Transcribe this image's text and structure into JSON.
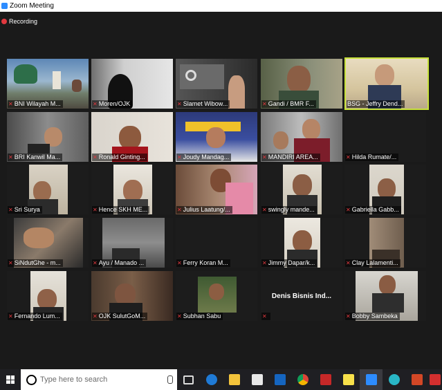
{
  "window": {
    "title": "Zoom Meeting"
  },
  "status": {
    "recording_label": "Recording"
  },
  "participants": [
    "BNI Wilayah M...",
    "Moren/OJK",
    "Slamet Wibow...",
    "Gandi / BMR F...",
    "BSG - Jeffry Dend...",
    "BRI Kanwil Ma...",
    "Ronald Ginting...",
    "Joudy Mandag...",
    "MANDIRI AREA...",
    "Hilda Rumate/...",
    "Sri Surya",
    "Hence SKH ME...",
    "Julius Laatung/...",
    "swingly mande...",
    "Gabriella Gabb...",
    "SiNdutGhe - m...",
    "Ayu / Manado ...",
    "Ferry Koran M...",
    "Jimmy Dapar/k...",
    "Clay Lalamenti...",
    "Fernando Lum...",
    "OJK SulutGoM...",
    "Subhan Sabu",
    "Denis Bisnis Ind...",
    "Bobby Sambeka"
  ],
  "center_name": "Denis Bisnis Ind...",
  "taskbar": {
    "search_placeholder": "Type here to search"
  }
}
